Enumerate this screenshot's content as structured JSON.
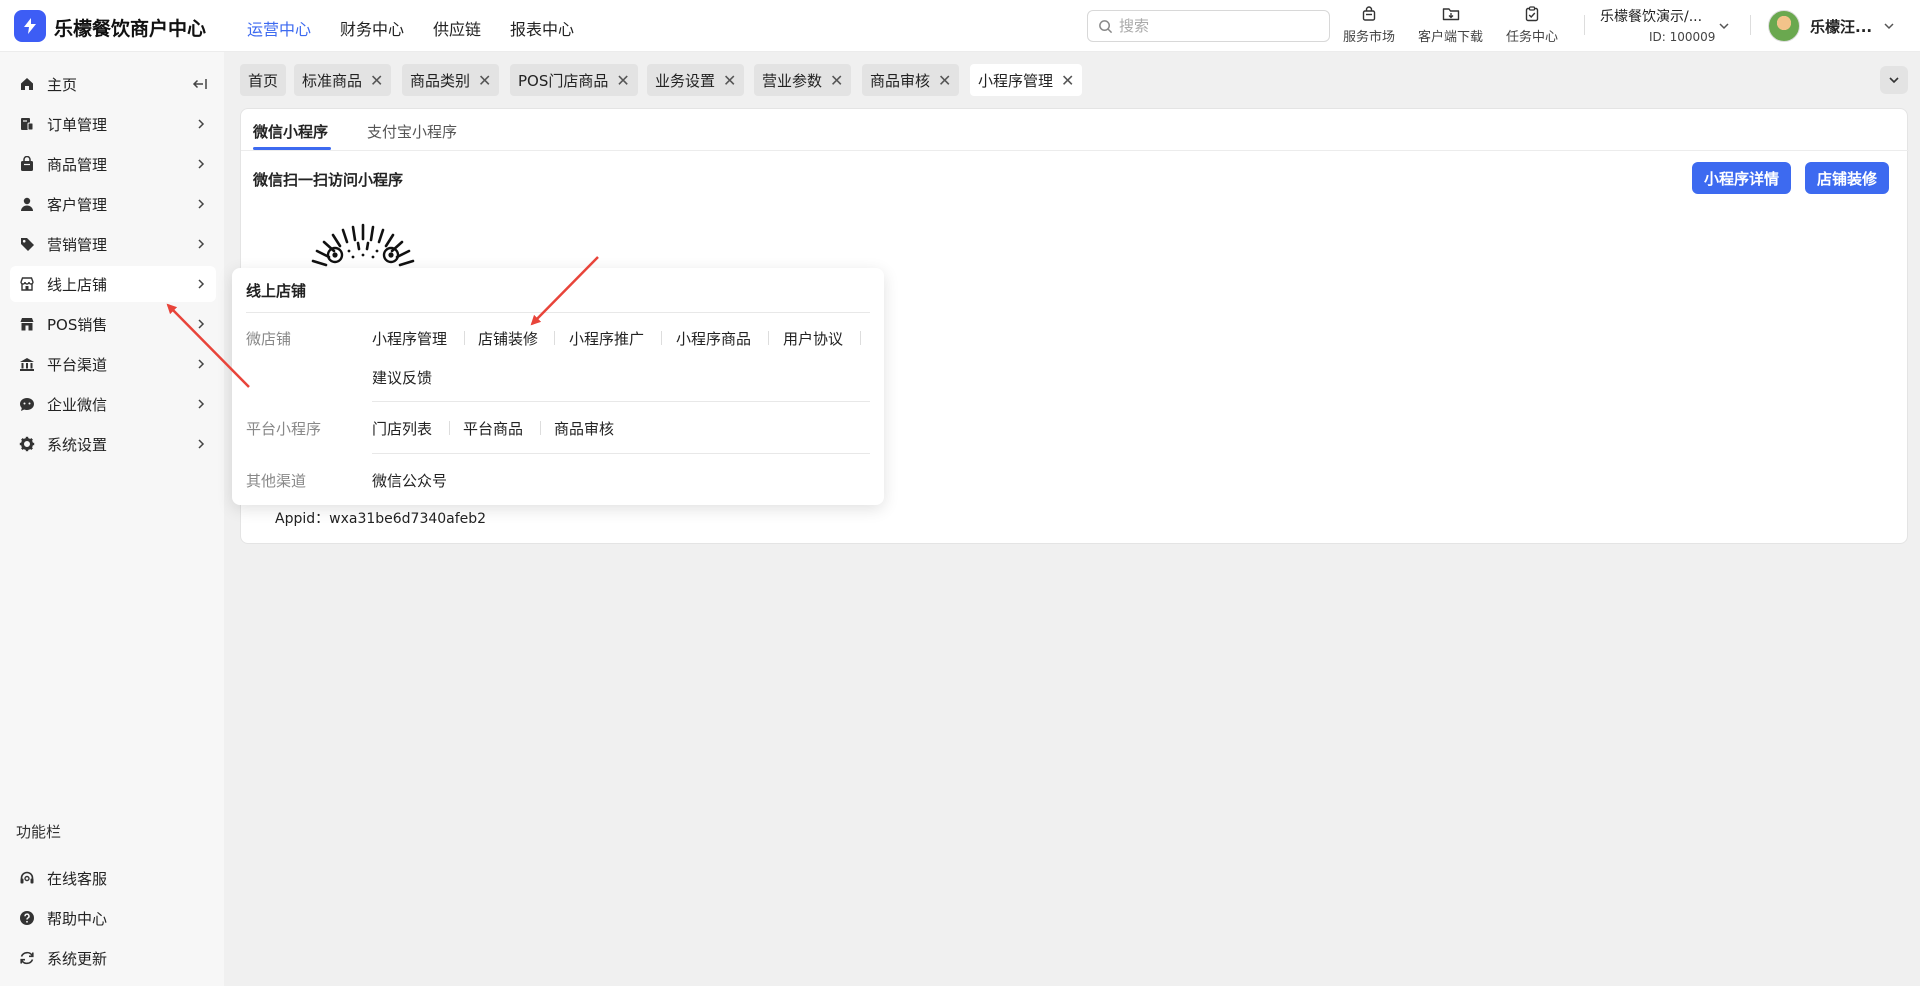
{
  "header": {
    "brand": "乐檬餐饮商户中心",
    "nav": [
      "运营中心",
      "财务中心",
      "供应链",
      "报表中心"
    ],
    "active_nav": "运营中心",
    "search_placeholder": "搜索",
    "tools": {
      "market": "服务市场",
      "client": "客户端下载",
      "tasks": "任务中心"
    },
    "account_name": "乐檬餐饮演示/...",
    "account_id": "ID: 100009",
    "user_name": "乐檬汪..."
  },
  "sidebar": {
    "items": [
      "主页",
      "订单管理",
      "商品管理",
      "客户管理",
      "营销管理",
      "线上店铺",
      "POS销售",
      "平台渠道",
      "企业微信",
      "系统设置"
    ],
    "active": "线上店铺",
    "section_title": "功能栏",
    "bottom_items": [
      "在线客服",
      "帮助中心",
      "系统更新"
    ]
  },
  "tabs": [
    "首页",
    "标准商品",
    "商品类别",
    "POS门店商品",
    "业务设置",
    "营业参数",
    "商品审核",
    "小程序管理"
  ],
  "active_tab": "小程序管理",
  "panel": {
    "subtabs": [
      "微信小程序",
      "支付宝小程序"
    ],
    "section_title": "微信扫一扫访问小程序",
    "btn_detail": "小程序详情",
    "btn_decor": "店铺装修",
    "appid": "Appid：wxa31be6d7340afeb2"
  },
  "flyout": {
    "title": "线上店铺",
    "groups": [
      {
        "name": "微店铺",
        "links": [
          "小程序管理",
          "店铺装修",
          "小程序推广",
          "小程序商品",
          "用户协议",
          "建议反馈"
        ]
      },
      {
        "name": "平台小程序",
        "links": [
          "门店列表",
          "平台商品",
          "商品审核"
        ]
      },
      {
        "name": "其他渠道",
        "links": [
          "微信公众号"
        ]
      }
    ]
  },
  "colors": {
    "accent": "#3d6af0",
    "logo": "#3d5df5",
    "annotation_arrow": "#e8443a"
  }
}
